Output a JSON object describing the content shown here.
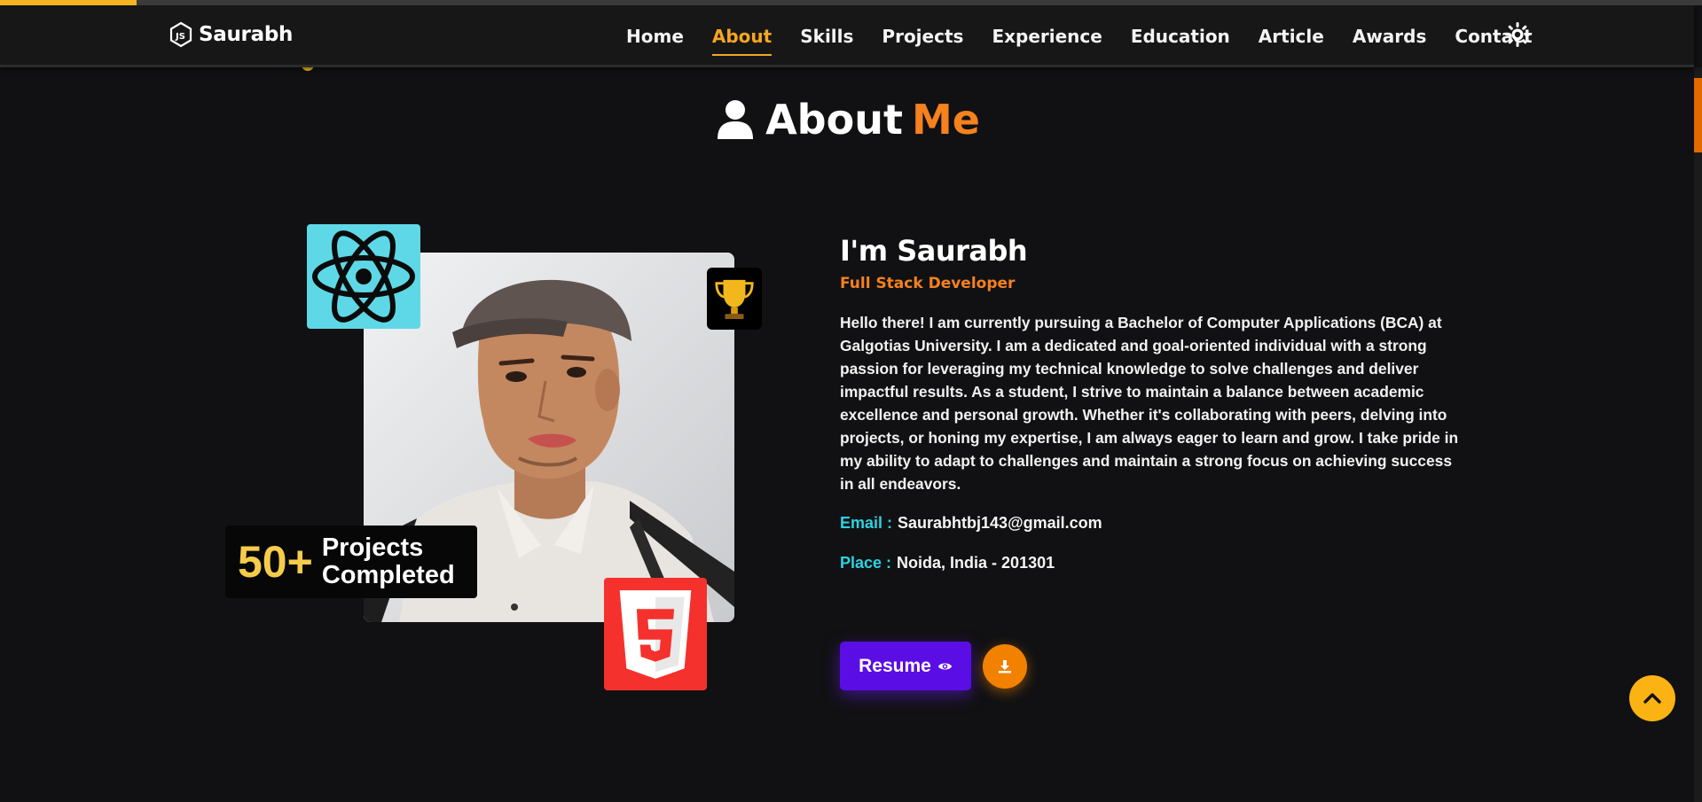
{
  "progress": {
    "fraction": 0.08
  },
  "navbar": {
    "brand": "Saurabh",
    "links": [
      {
        "label": "Home",
        "active": false
      },
      {
        "label": "About",
        "active": true
      },
      {
        "label": "Skills",
        "active": false
      },
      {
        "label": "Projects",
        "active": false
      },
      {
        "label": "Experience",
        "active": false
      },
      {
        "label": "Education",
        "active": false
      },
      {
        "label": "Article",
        "active": false
      },
      {
        "label": "Awards",
        "active": false
      },
      {
        "label": "Contact",
        "active": false
      }
    ],
    "theme_icon": "sun-icon"
  },
  "section": {
    "title_main": "About",
    "title_accent": "Me",
    "icon": "user-icon"
  },
  "badges": {
    "projects_count": "50+",
    "projects_label": "Projects Completed",
    "react_icon": "react-icon",
    "trophy_icon": "trophy-icon",
    "html_icon": "html5-icon"
  },
  "about": {
    "name": "I'm Saurabh",
    "role": "Full Stack Developer",
    "bio": "Hello there! I am currently pursuing a Bachelor of Computer Applications (BCA) at Galgotias University. I am a dedicated and goal-oriented individual with a strong passion for leveraging my technical knowledge to solve challenges and deliver impactful results. As a student, I strive to maintain a balance between academic excellence and personal growth. Whether it's collaborating with peers, delving into projects, or honing my expertise, I am always eager to learn and grow. I take pride in my ability to adapt to challenges and maintain a strong focus on achieving success in all endeavors.",
    "email_label": "Email :",
    "email_value": "Saurabhtbj143@gmail.com",
    "place_label": "Place :",
    "place_value": "Noida, India - 201301"
  },
  "buttons": {
    "resume_label": "Resume",
    "resume_icon": "eye-icon",
    "download_icon": "download-icon",
    "scroll_top_icon": "chevron-up-icon"
  },
  "colors": {
    "accent_orange": "#f5811f",
    "accent_cyan": "#2bd3e1",
    "resume_purple": "#5b0de6",
    "background": "#111113"
  }
}
